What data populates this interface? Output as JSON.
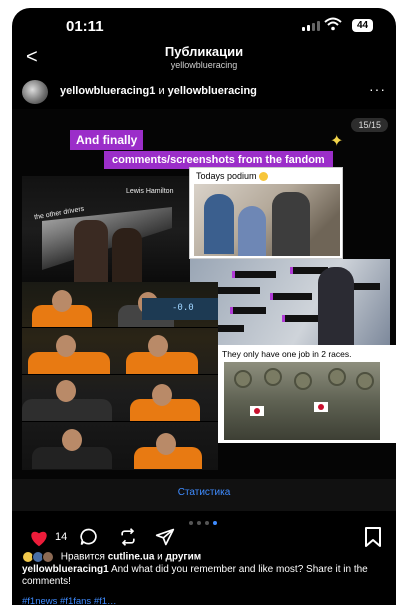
{
  "status_bar": {
    "time": "01:11",
    "battery": "44"
  },
  "navbar": {
    "back_symbol": "<",
    "title": "Публикации",
    "subtitle": "yellowblueracing"
  },
  "post": {
    "author1": "yellowblueracing1",
    "author_separator": "и",
    "author2": "yellowblueracing",
    "more_symbol": "···"
  },
  "media": {
    "counter": "15/15",
    "heading_line1": "And finally",
    "heading_line2": "comments/screenshots from the fandom",
    "caption_other_drivers": "the other drivers",
    "caption_lewis": "Lewis Hamilton",
    "caption_podium": "Todays podium",
    "caption_one_job": "They only have one job in 2 races.",
    "screen_text": "-0.0"
  },
  "statistics_label": "Статистика",
  "actions": {
    "likes_count": "14"
  },
  "likes_line": {
    "prefix": "Нравится",
    "user": "cutline.ua",
    "joiner": "и",
    "suffix": "другим"
  },
  "caption": {
    "author": "yellowblueracing1",
    "text": "And what did you remember and like most? Share it in the comments!"
  },
  "hashtags": "#f1news #f1fans #f1…",
  "colors": {
    "accent_blue": "#3f8cff",
    "like_red": "#ed1c3a",
    "tag_purple": "#9b2ec9"
  }
}
